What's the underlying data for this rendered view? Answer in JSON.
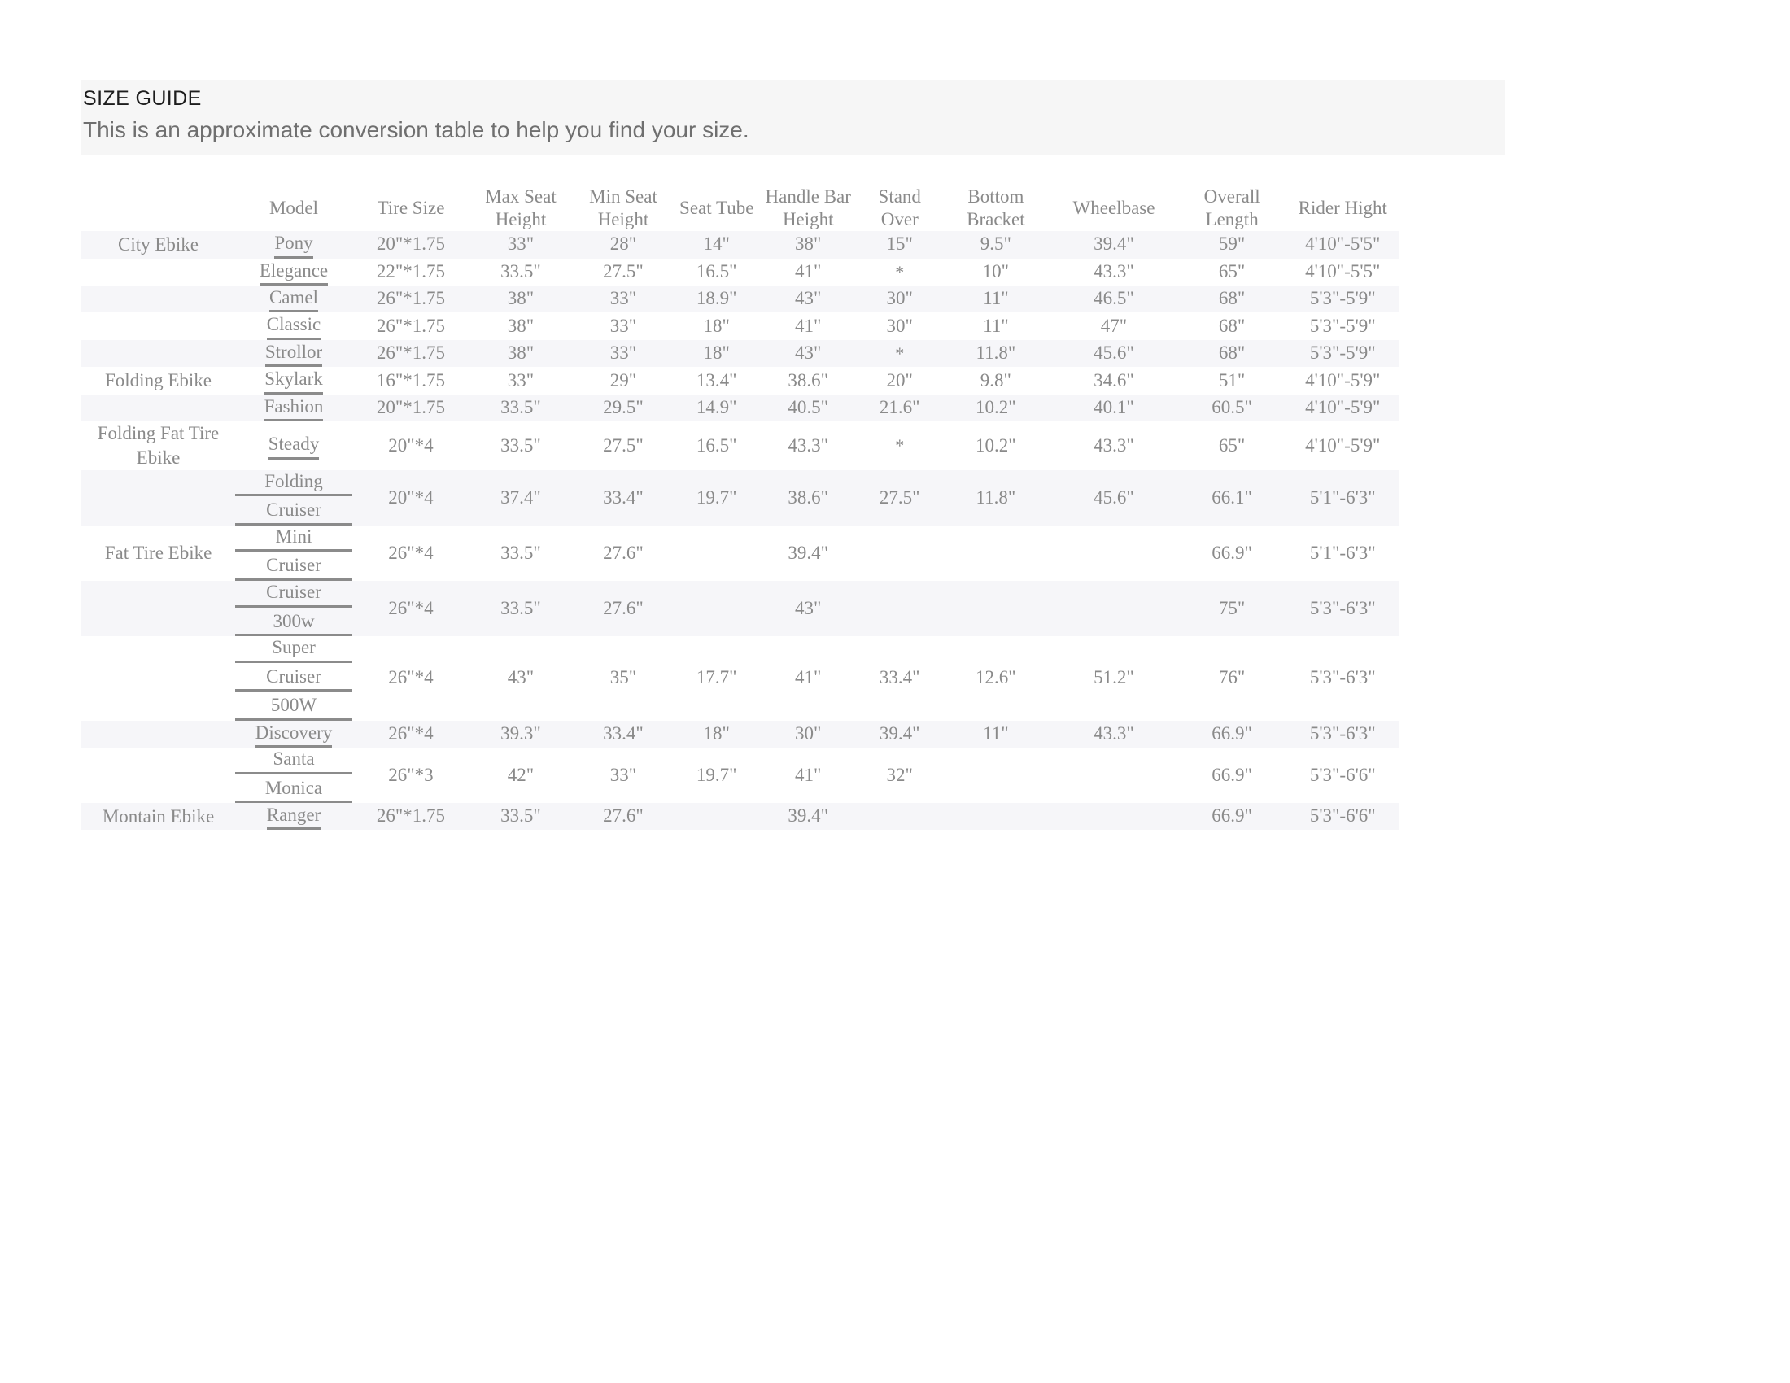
{
  "heading": {
    "title": "SIZE GUIDE",
    "subtitle": "This is an approximate conversion table to help you find your size."
  },
  "table": {
    "columns": [
      {
        "key": "category",
        "label": ""
      },
      {
        "key": "model",
        "label": "Model"
      },
      {
        "key": "tire_size",
        "label": "Tire Size"
      },
      {
        "key": "max_seat_height",
        "label": "Max Seat Height"
      },
      {
        "key": "min_seat_height",
        "label": "Min Seat Height"
      },
      {
        "key": "seat_tube",
        "label": "Seat Tube"
      },
      {
        "key": "handle_bar_height",
        "label": "Handle Bar Height"
      },
      {
        "key": "stand_over",
        "label": "Stand Over"
      },
      {
        "key": "bottom_bracket",
        "label": "Bottom Bracket"
      },
      {
        "key": "wheelbase",
        "label": "Wheelbase"
      },
      {
        "key": "overall_length",
        "label": "Overall Length"
      },
      {
        "key": "rider_hight",
        "label": "Rider Hight"
      }
    ],
    "rows": [
      {
        "category": "City Ebike",
        "model": [
          "Pony"
        ],
        "tire_size": "20\"*1.75",
        "max_seat_height": "33\"",
        "min_seat_height": "28\"",
        "seat_tube": "14\"",
        "handle_bar_height": "38\"",
        "stand_over": "15\"",
        "bottom_bracket": "9.5\"",
        "wheelbase": "39.4\"",
        "overall_length": "59\"",
        "rider_hight": "4'10\"-5'5\""
      },
      {
        "category": "",
        "model": [
          "Elegance"
        ],
        "tire_size": "22\"*1.75",
        "max_seat_height": "33.5\"",
        "min_seat_height": "27.5\"",
        "seat_tube": "16.5\"",
        "handle_bar_height": "41\"",
        "stand_over": "*",
        "bottom_bracket": "10\"",
        "wheelbase": "43.3\"",
        "overall_length": "65\"",
        "rider_hight": "4'10\"-5'5\""
      },
      {
        "category": "",
        "model": [
          "Camel"
        ],
        "tire_size": "26\"*1.75",
        "max_seat_height": "38\"",
        "min_seat_height": "33\"",
        "seat_tube": "18.9\"",
        "handle_bar_height": "43\"",
        "stand_over": "30\"",
        "bottom_bracket": "11\"",
        "wheelbase": "46.5\"",
        "overall_length": "68\"",
        "rider_hight": "5'3\"-5'9\""
      },
      {
        "category": "",
        "model": [
          "Classic"
        ],
        "tire_size": "26\"*1.75",
        "max_seat_height": "38\"",
        "min_seat_height": "33\"",
        "seat_tube": "18\"",
        "handle_bar_height": "41\"",
        "stand_over": "30\"",
        "bottom_bracket": "11\"",
        "wheelbase": "47\"",
        "overall_length": "68\"",
        "rider_hight": "5'3\"-5'9\""
      },
      {
        "category": "",
        "model": [
          "Strollor"
        ],
        "tire_size": "26\"*1.75",
        "max_seat_height": "38\"",
        "min_seat_height": "33\"",
        "seat_tube": "18\"",
        "handle_bar_height": "43\"",
        "stand_over": "*",
        "bottom_bracket": "11.8\"",
        "wheelbase": "45.6\"",
        "overall_length": "68\"",
        "rider_hight": "5'3\"-5'9\""
      },
      {
        "category": "Folding Ebike",
        "model": [
          "Skylark"
        ],
        "tire_size": "16\"*1.75",
        "max_seat_height": "33\"",
        "min_seat_height": "29\"",
        "seat_tube": "13.4\"",
        "handle_bar_height": "38.6\"",
        "stand_over": "20\"",
        "bottom_bracket": "9.8\"",
        "wheelbase": "34.6\"",
        "overall_length": "51\"",
        "rider_hight": "4'10\"-5'9\""
      },
      {
        "category": "",
        "model": [
          "Fashion"
        ],
        "tire_size": "20\"*1.75",
        "max_seat_height": "33.5\"",
        "min_seat_height": "29.5\"",
        "seat_tube": "14.9\"",
        "handle_bar_height": "40.5\"",
        "stand_over": "21.6\"",
        "bottom_bracket": "10.2\"",
        "wheelbase": "40.1\"",
        "overall_length": "60.5\"",
        "rider_hight": "4'10\"-5'9\""
      },
      {
        "category": "Folding Fat Tire Ebike",
        "model": [
          "Steady"
        ],
        "tire_size": "20\"*4",
        "max_seat_height": "33.5\"",
        "min_seat_height": "27.5\"",
        "seat_tube": "16.5\"",
        "handle_bar_height": "43.3\"",
        "stand_over": "*",
        "bottom_bracket": "10.2\"",
        "wheelbase": "43.3\"",
        "overall_length": "65\"",
        "rider_hight": "4'10\"-5'9\""
      },
      {
        "category": "",
        "model": [
          "Folding",
          "Cruiser"
        ],
        "tire_size": "20\"*4",
        "max_seat_height": "37.4\"",
        "min_seat_height": "33.4\"",
        "seat_tube": "19.7\"",
        "handle_bar_height": "38.6\"",
        "stand_over": "27.5\"",
        "bottom_bracket": "11.8\"",
        "wheelbase": "45.6\"",
        "overall_length": "66.1\"",
        "rider_hight": "5'1\"-6'3\""
      },
      {
        "category": "Fat Tire Ebike",
        "model": [
          "Mini",
          "Cruiser"
        ],
        "tire_size": "26\"*4",
        "max_seat_height": "33.5\"",
        "min_seat_height": "27.6\"",
        "seat_tube": "",
        "handle_bar_height": "39.4\"",
        "stand_over": "",
        "bottom_bracket": "",
        "wheelbase": "",
        "overall_length": "66.9\"",
        "rider_hight": "5'1\"-6'3\""
      },
      {
        "category": "",
        "model": [
          "Cruiser",
          "300w"
        ],
        "tire_size": "26\"*4",
        "max_seat_height": "33.5\"",
        "min_seat_height": "27.6\"",
        "seat_tube": "",
        "handle_bar_height": "43\"",
        "stand_over": "",
        "bottom_bracket": "",
        "wheelbase": "",
        "overall_length": "75\"",
        "rider_hight": "5'3\"-6'3\""
      },
      {
        "category": "",
        "model": [
          "Super",
          "Cruiser",
          "500W"
        ],
        "tire_size": "26\"*4",
        "max_seat_height": "43\"",
        "min_seat_height": "35\"",
        "seat_tube": "17.7\"",
        "handle_bar_height": "41\"",
        "stand_over": "33.4\"",
        "bottom_bracket": "12.6\"",
        "wheelbase": "51.2\"",
        "overall_length": "76\"",
        "rider_hight": "5'3\"-6'3\""
      },
      {
        "category": "",
        "model": [
          "Discovery"
        ],
        "tire_size": "26\"*4",
        "max_seat_height": "39.3\"",
        "min_seat_height": "33.4\"",
        "seat_tube": "18\"",
        "handle_bar_height": "30\"",
        "stand_over": "39.4\"",
        "bottom_bracket": "11\"",
        "wheelbase": "43.3\"",
        "overall_length": "66.9\"",
        "rider_hight": "5'3\"-6'3\""
      },
      {
        "category": "",
        "model": [
          "Santa",
          "Monica"
        ],
        "tire_size": "26\"*3",
        "max_seat_height": "42\"",
        "min_seat_height": "33\"",
        "seat_tube": "19.7\"",
        "handle_bar_height": "41\"",
        "stand_over": "32\"",
        "bottom_bracket": "",
        "wheelbase": "",
        "overall_length": "66.9\"",
        "rider_hight": "5'3\"-6'6\""
      },
      {
        "category": "Montain Ebike",
        "model": [
          "Ranger"
        ],
        "tire_size": "26\"*1.75",
        "max_seat_height": "33.5\"",
        "min_seat_height": "27.6\"",
        "seat_tube": "",
        "handle_bar_height": "39.4\"",
        "stand_over": "",
        "bottom_bracket": "",
        "wheelbase": "",
        "overall_length": "66.9\"",
        "rider_hight": "5'3\"-6'6\""
      }
    ]
  },
  "colors": {
    "heading_band": "#f6f6f6",
    "stripe": "#f6f6f9",
    "text_muted": "#8a8a8a",
    "title": "#1d1d1d"
  }
}
